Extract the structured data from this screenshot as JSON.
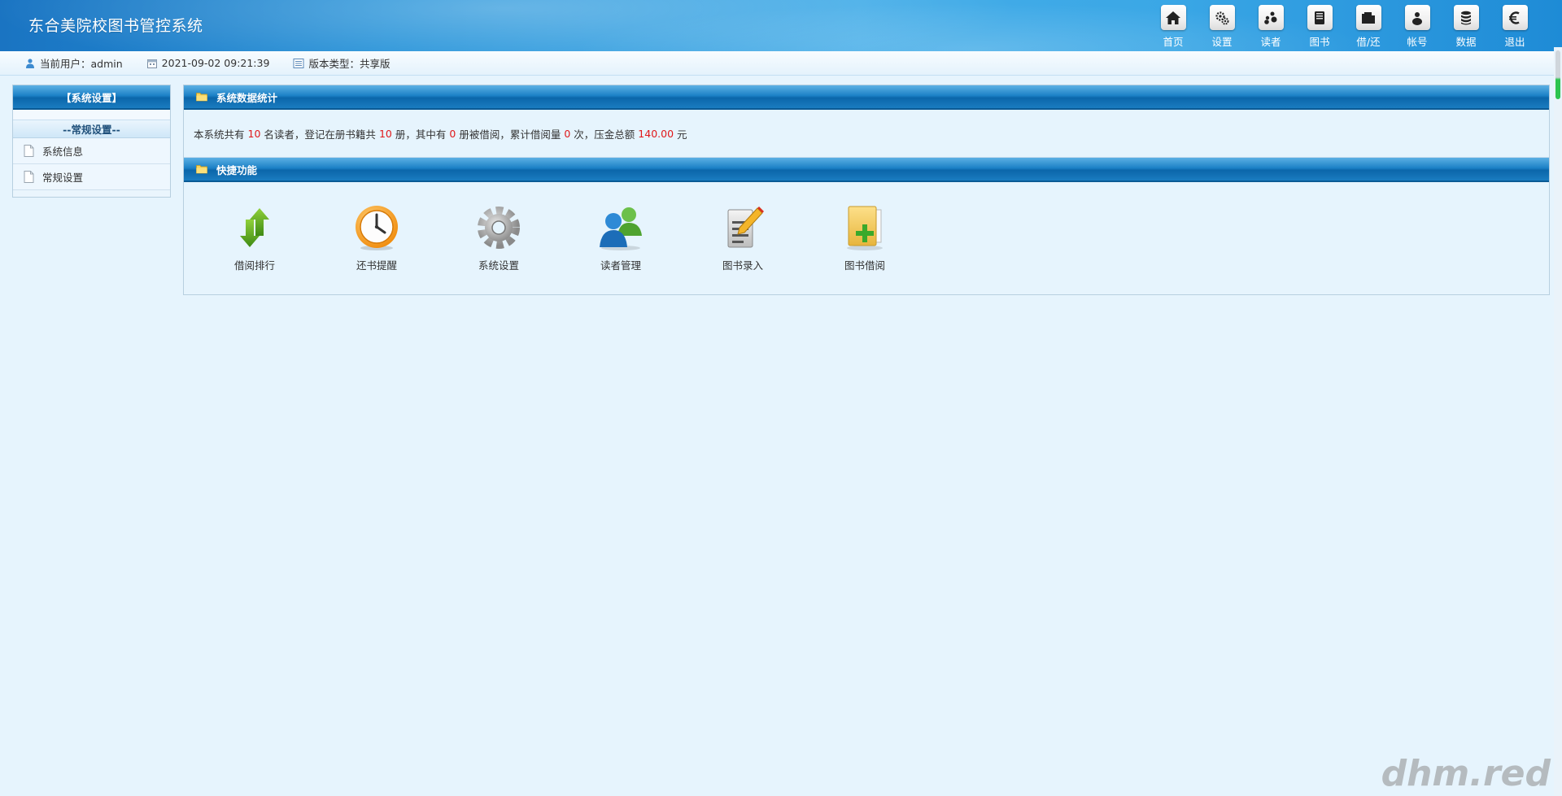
{
  "app": {
    "title": "东合美院校图书管控系统"
  },
  "top_nav": [
    {
      "label": "首页",
      "icon": "home-icon"
    },
    {
      "label": "设置",
      "icon": "gears-icon"
    },
    {
      "label": "读者",
      "icon": "users-icon"
    },
    {
      "label": "图书",
      "icon": "book-icon"
    },
    {
      "label": "借/还",
      "icon": "folder-icon"
    },
    {
      "label": "帐号",
      "icon": "user-icon"
    },
    {
      "label": "数据",
      "icon": "database-icon"
    },
    {
      "label": "退出",
      "icon": "euro-icon"
    }
  ],
  "status_bar": {
    "user": "当前用户：admin",
    "datetime": "2021-09-02 09:21:39",
    "version": "版本类型：共享版"
  },
  "sidebar": {
    "title": "【系统设置】",
    "group": "--常规设置--",
    "items": [
      {
        "label": "系统信息"
      },
      {
        "label": "常规设置"
      }
    ]
  },
  "stats_panel": {
    "title": "系统数据统计",
    "t1": "本系统共有",
    "readers": "10",
    "t2": "名读者，登记在册书籍共",
    "books": "10",
    "t3": "册，其中有",
    "borrowed": "0",
    "t4": "册被借阅，累计借阅量",
    "total_borrow": "0",
    "t5": "次，压金总额",
    "deposit": "140.00",
    "t6": "元"
  },
  "quick_panel": {
    "title": "快捷功能",
    "items": [
      {
        "label": "借阅排行",
        "icon": "arrows-icon"
      },
      {
        "label": "还书提醒",
        "icon": "clock-icon"
      },
      {
        "label": "系统设置",
        "icon": "gear-icon"
      },
      {
        "label": "读者管理",
        "icon": "readers-icon"
      },
      {
        "label": "图书录入",
        "icon": "document-edit-icon"
      },
      {
        "label": "图书借阅",
        "icon": "folder-add-icon"
      }
    ]
  },
  "watermark": "dhm.red",
  "colors": {
    "accent_blue": "#1c81c6",
    "stat_number": "#e0191a",
    "background": "#e6f4fd"
  }
}
